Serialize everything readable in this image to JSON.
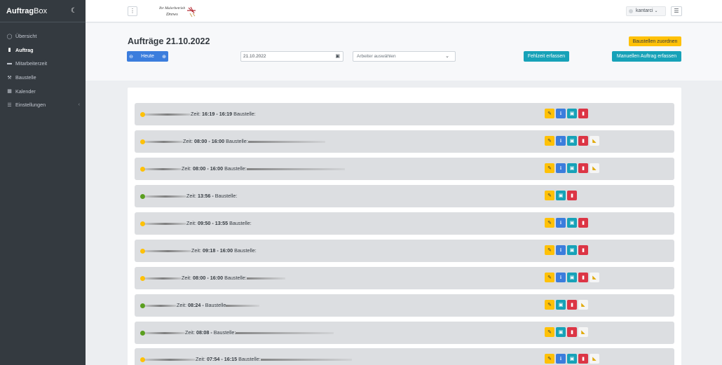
{
  "app": {
    "brand_bold": "Auftrag",
    "brand_light": "Box",
    "theme_icon": "moon-icon"
  },
  "sidebar": {
    "items": [
      {
        "label": "Übersicht",
        "icon": "circle-icon",
        "active": false
      },
      {
        "label": "Auftrag",
        "icon": "file-icon",
        "active": true
      },
      {
        "label": "Mitarbeiterzeit",
        "icon": "truck-icon",
        "active": false
      },
      {
        "label": "Baustelle",
        "icon": "worker-icon",
        "active": false
      },
      {
        "label": "Kalender",
        "icon": "calendar-icon",
        "active": false
      },
      {
        "label": "Einstellungen",
        "icon": "sliders-icon",
        "active": false,
        "chevron": "‹"
      }
    ]
  },
  "topbar": {
    "menu_icon": "⋮",
    "logo_line1": "Ihr Malerbetrieb",
    "logo_line2": "Drews",
    "user": "kantarci",
    "list_icon": "☰"
  },
  "header": {
    "title": "Aufträge 21.10.2022",
    "heute_label": "Heute",
    "prev_icon": "⊖",
    "next_icon": "⊕",
    "date_value": "21.10.2022",
    "worker_placeholder": "Arbeiter auswählen",
    "fehlzeit_label": "Fehlzeit erfassen",
    "manual_label": "Manuellen Auftrag erfassen",
    "baustellen_label": "Baustellen zuordnen"
  },
  "orders": [
    {
      "status": "yellow",
      "zeit_label": "Zeit:",
      "time": "16:19 - 16:19",
      "baustelle_label": "Baustelle:",
      "extra": false,
      "info": true
    },
    {
      "status": "yellow",
      "zeit_label": "Zeit:",
      "time": "08:00 - 16:00",
      "baustelle_label": "Baustelle:",
      "extra": true,
      "info": true
    },
    {
      "status": "yellow",
      "zeit_label": "Zeit:",
      "time": "08:00 - 16:00",
      "baustelle_label": "Baustelle:",
      "extra": true,
      "info": true
    },
    {
      "status": "green",
      "zeit_label": "Zeit:",
      "time": "13:56 -",
      "baustelle_label": "Baustelle:",
      "extra": false,
      "info": false
    },
    {
      "status": "yellow",
      "zeit_label": "Zeit:",
      "time": "09:50 - 13:55",
      "baustelle_label": "Baustelle:",
      "extra": false,
      "info": true
    },
    {
      "status": "yellow",
      "zeit_label": "Zeit:",
      "time": "09:18 - 16:00",
      "baustelle_label": "Baustelle:",
      "extra": false,
      "info": true
    },
    {
      "status": "yellow",
      "zeit_label": "Zeit:",
      "time": "08:00 - 16:00",
      "baustelle_label": "Baustelle:",
      "extra": true,
      "info": true
    },
    {
      "status": "green",
      "zeit_label": "Zeit:",
      "time": "08:24 -",
      "baustelle_label": "Baustelle",
      "extra": true,
      "info": false
    },
    {
      "status": "green",
      "zeit_label": "Zeit:",
      "time": "08:08 -",
      "baustelle_label": "Baustelle:",
      "extra": true,
      "info": false
    },
    {
      "status": "yellow",
      "zeit_label": "Zeit:",
      "time": "07:54 - 16:15",
      "baustelle_label": "Baustelle:",
      "extra": true,
      "info": true
    }
  ],
  "colors": {
    "sidebar_bg": "#343a40",
    "primary": "#3b7ddd",
    "info": "#17a2b8",
    "warning": "#ffc107",
    "danger": "#dc3545",
    "status_yellow": "#ffc107",
    "status_green": "#5a9f1f"
  }
}
